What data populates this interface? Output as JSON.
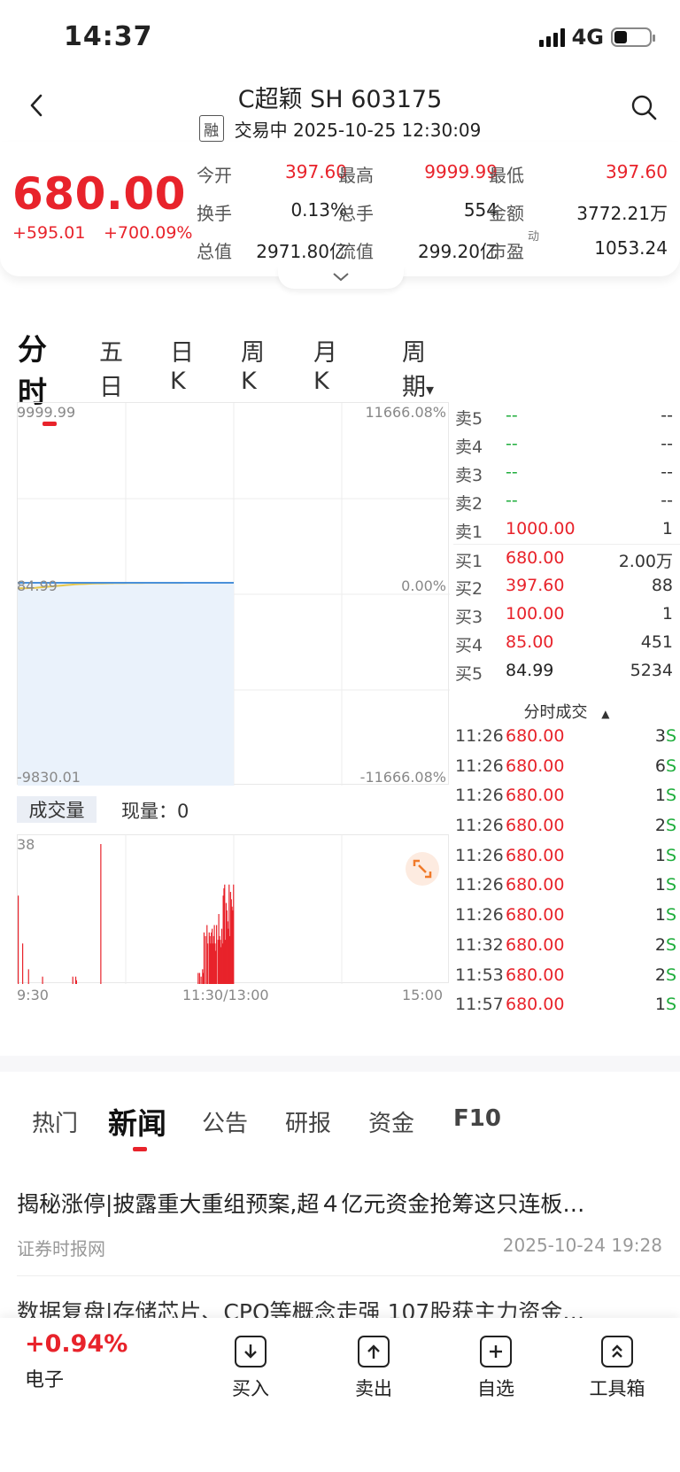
{
  "status_bar": {
    "time": "14:37",
    "network": "4G"
  },
  "header": {
    "title": "C超颖 SH 603175",
    "margin_badge": "融",
    "trade_status": "交易中 2025-10-25 12:30:09"
  },
  "quote": {
    "price": "680.00",
    "change": "+595.01",
    "change_pct": "+700.09%",
    "stats": [
      [
        {
          "label": "今开",
          "value": "397.60",
          "color": "red"
        },
        {
          "label": "最高",
          "value": "9999.99",
          "color": "red"
        },
        {
          "label": "最低",
          "value": "397.60",
          "color": "red"
        }
      ],
      [
        {
          "label": "换手",
          "value": "0.13%",
          "color": "dark"
        },
        {
          "label": "总手",
          "value": "554",
          "color": "dark"
        },
        {
          "label": "金额",
          "value": "3772.21万",
          "color": "dark"
        }
      ],
      [
        {
          "label": "总值",
          "value": "2971.80亿",
          "color": "dark"
        },
        {
          "label": "流值",
          "value": "299.20亿",
          "color": "dark"
        },
        {
          "label": "市盈",
          "sup": "动",
          "value": "1053.24",
          "color": "dark"
        }
      ]
    ]
  },
  "chart_tabs": [
    "分时",
    "五日",
    "日 K",
    "周 K",
    "月 K",
    "周　期"
  ],
  "chart_tabs_dropdown": "▾",
  "chart_data": {
    "type": "line",
    "title": "",
    "y_axis_left": [
      "9999.99",
      "84.99",
      "-9830.01"
    ],
    "y_axis_right": [
      "11666.08%",
      "0.00%",
      "-11666.08%"
    ],
    "x_ticks": [
      "9:30",
      "11:30/13:00",
      "15:00"
    ],
    "series": [
      {
        "name": "price",
        "color": "#4a90d9",
        "values": [
          680,
          680,
          680,
          680,
          680,
          680,
          680,
          680,
          680,
          680,
          680,
          680,
          680,
          680,
          680,
          680,
          680,
          680,
          680,
          680,
          680,
          680,
          680,
          680,
          680,
          680,
          680,
          680,
          680,
          680,
          680,
          680,
          680,
          680,
          680,
          680,
          680,
          680,
          680,
          680,
          680,
          680,
          680,
          680,
          680,
          680,
          680,
          680,
          680,
          680
        ]
      },
      {
        "name": "avg",
        "color": "#e6c74a",
        "values": [
          397.6,
          398,
          400,
          410,
          420,
          440,
          460,
          480,
          500,
          520,
          540,
          560,
          580,
          600,
          610,
          620,
          630,
          640,
          645,
          650,
          655,
          660,
          662,
          664,
          666,
          668,
          670,
          672,
          673,
          674,
          675,
          676,
          676,
          677,
          677,
          678,
          678,
          678,
          679,
          679,
          679,
          679,
          679,
          680,
          680,
          680,
          680,
          680,
          680,
          680
        ]
      }
    ],
    "ylim": [
      -9830.01,
      9999.99
    ],
    "baseline": 84.99,
    "volume": {
      "label": "成交量",
      "current_label": "现量：",
      "current_value": "0",
      "max_label": "38",
      "bars": [
        24,
        0,
        0,
        0,
        0,
        0,
        11,
        0,
        0,
        0,
        0,
        0,
        0,
        0,
        4,
        0,
        0,
        0,
        0,
        0,
        0,
        0,
        0,
        0,
        0,
        0,
        0,
        0,
        0,
        0,
        0,
        0,
        0,
        2,
        0,
        0,
        0,
        0,
        0,
        0,
        0,
        0,
        0,
        0,
        0,
        0,
        0,
        0,
        0,
        0,
        0,
        0,
        0,
        0,
        0,
        0,
        0,
        0,
        0,
        0,
        0,
        0,
        0,
        0,
        0,
        0,
        0,
        0,
        0,
        0,
        0,
        0,
        0,
        0,
        2,
        0,
        0,
        0,
        2,
        1,
        0,
        0,
        0,
        0,
        0,
        0,
        0,
        0,
        0,
        0,
        0,
        0,
        0,
        0,
        0,
        0,
        0,
        0,
        0,
        0,
        0,
        0,
        0,
        0,
        0,
        0,
        0,
        0,
        0,
        0,
        0,
        0,
        38,
        0,
        0,
        0,
        0,
        0,
        0,
        0,
        0,
        0,
        0,
        0,
        0,
        0,
        0,
        0,
        0,
        0,
        0,
        0,
        0,
        0,
        0,
        0,
        0,
        0,
        0,
        0,
        0,
        0,
        0,
        0,
        0,
        0,
        0,
        0,
        0,
        0,
        0,
        0,
        0,
        0,
        0,
        0,
        0,
        0,
        0,
        0,
        0,
        0,
        0,
        0,
        0,
        0,
        0,
        0,
        0,
        0,
        0,
        0,
        0,
        0,
        0,
        0,
        0,
        0,
        0,
        0,
        0,
        0,
        0,
        0,
        0,
        0,
        0,
        0,
        0,
        0,
        0,
        0,
        0,
        0,
        0,
        0,
        0,
        0,
        0,
        0,
        0,
        0,
        0,
        0,
        0,
        0,
        0,
        0,
        0,
        0,
        0,
        0,
        0,
        0,
        0,
        0,
        0,
        0,
        0,
        0,
        0,
        0,
        0,
        0,
        0,
        0,
        0,
        0,
        0,
        0,
        0,
        0,
        0,
        0,
        0,
        0,
        0,
        0,
        0,
        0,
        0,
        0,
        0,
        0,
        3,
        0,
        3,
        0,
        2,
        0,
        4,
        3,
        14,
        0,
        13,
        0,
        16,
        11,
        0,
        14,
        13,
        11,
        14,
        15,
        11,
        13,
        16,
        11,
        9,
        16,
        0,
        12,
        19,
        13,
        12,
        10,
        15,
        11,
        24,
        26,
        27,
        12,
        22,
        20,
        17,
        15,
        27,
        13,
        25,
        23,
        21,
        20,
        27
      ]
    }
  },
  "order_book": {
    "asks": [
      {
        "label": "卖5",
        "price": "--",
        "qty": "--"
      },
      {
        "label": "卖4",
        "price": "--",
        "qty": "--"
      },
      {
        "label": "卖3",
        "price": "--",
        "qty": "--"
      },
      {
        "label": "卖2",
        "price": "--",
        "qty": "--"
      },
      {
        "label": "卖1",
        "price": "1000.00",
        "qty": "1"
      }
    ],
    "bids": [
      {
        "label": "买1",
        "price": "680.00",
        "qty": "2.00万"
      },
      {
        "label": "买2",
        "price": "397.60",
        "qty": "88"
      },
      {
        "label": "买3",
        "price": "100.00",
        "qty": "1"
      },
      {
        "label": "买4",
        "price": "85.00",
        "qty": "451"
      },
      {
        "label": "买5",
        "price": "84.99",
        "qty": "5234"
      }
    ]
  },
  "trades": {
    "title": "分时成交",
    "sort_icon": "▲",
    "rows": [
      {
        "time": "11:26",
        "price": "680.00",
        "qty": "3",
        "side": "S"
      },
      {
        "time": "11:26",
        "price": "680.00",
        "qty": "6",
        "side": "S"
      },
      {
        "time": "11:26",
        "price": "680.00",
        "qty": "1",
        "side": "S"
      },
      {
        "time": "11:26",
        "price": "680.00",
        "qty": "2",
        "side": "S"
      },
      {
        "time": "11:26",
        "price": "680.00",
        "qty": "1",
        "side": "S"
      },
      {
        "time": "11:26",
        "price": "680.00",
        "qty": "1",
        "side": "S"
      },
      {
        "time": "11:26",
        "price": "680.00",
        "qty": "1",
        "side": "S"
      },
      {
        "time": "11:32",
        "price": "680.00",
        "qty": "2",
        "side": "S"
      },
      {
        "time": "11:53",
        "price": "680.00",
        "qty": "2",
        "side": "S"
      },
      {
        "time": "11:57",
        "price": "680.00",
        "qty": "1",
        "side": "S"
      }
    ]
  },
  "news_tabs": [
    "热门",
    "新闻",
    "公告",
    "研报",
    "资金",
    "F10"
  ],
  "news": [
    {
      "title": "揭秘涨停|披露重大重组预案,超４亿元资金抢筹这只连板…",
      "source": "证券时报网",
      "time": "2025-10-24 19:28"
    },
    {
      "title": "数据复盘|存储芯片、CPO等概念走强 107股获主力资金…"
    }
  ],
  "bottom_bar": {
    "sector_pct": "+0.94%",
    "sector_name": "电子",
    "buttons": [
      "买入",
      "卖出",
      "自选",
      "工具箱"
    ]
  },
  "colors": {
    "up": "#e8232b",
    "down": "#1fae3c",
    "accent": "#e8232b",
    "price_line": "#4a90d9",
    "avg_line": "#e6c74a",
    "fill": "#eaf2fb"
  }
}
